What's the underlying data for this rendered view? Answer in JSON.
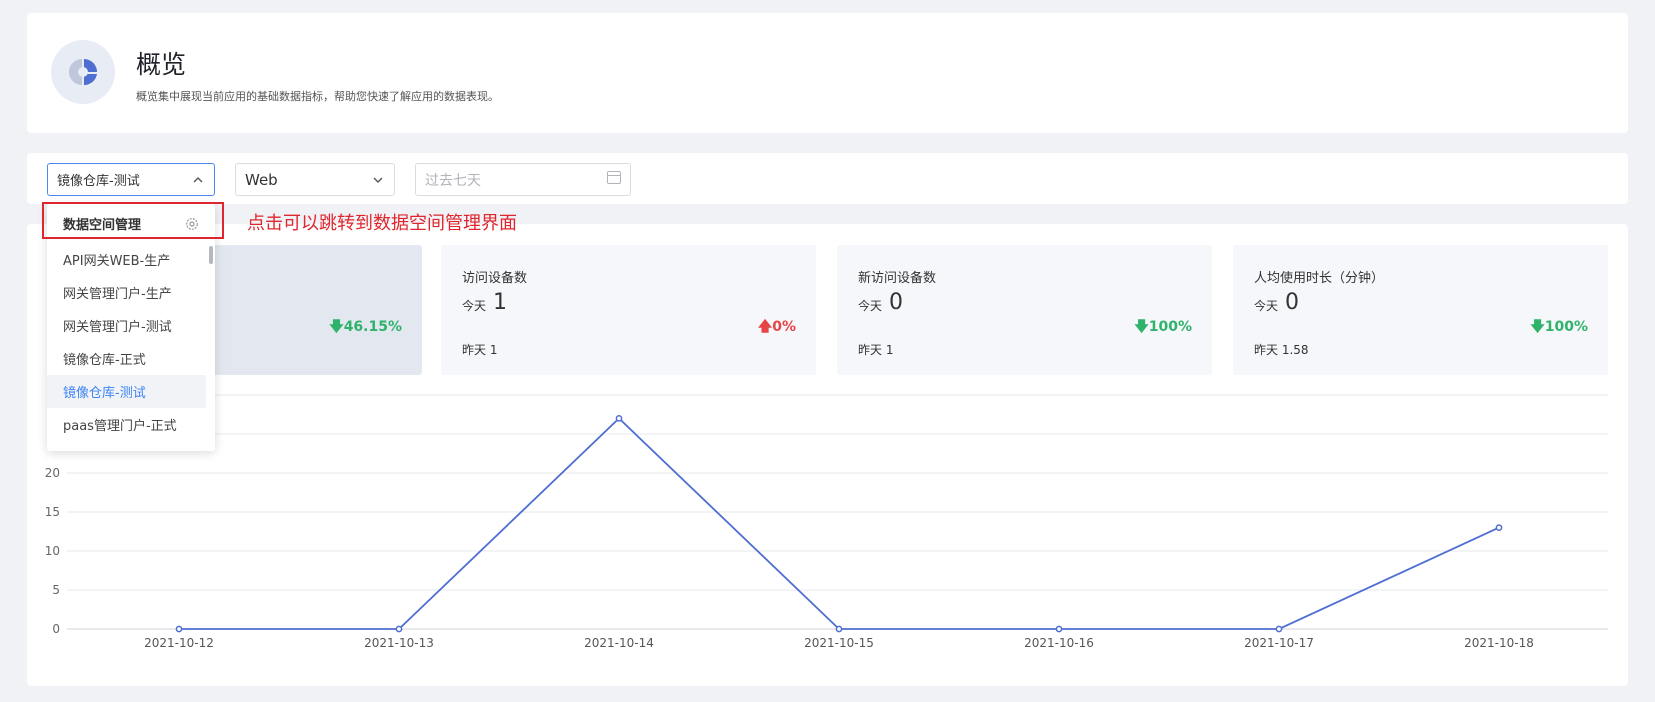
{
  "header": {
    "title": "概览",
    "description": "概览集中展现当前应用的基础数据指标，帮助您快速了解应用的数据表现。",
    "logo_icon": "pie-chart-icon"
  },
  "filters": {
    "app_select": {
      "value": "镜像仓库-测试"
    },
    "platform_select": {
      "value": "Web"
    },
    "date_picker": {
      "placeholder": "过去七天"
    }
  },
  "dropdown": {
    "header": "数据空间管理",
    "header_icon": "gear-icon",
    "items": [
      {
        "label": "API网关WEB-生产"
      },
      {
        "label": "网关管理门户-生产"
      },
      {
        "label": "网关管理门户-测试"
      },
      {
        "label": "镜像仓库-正式"
      },
      {
        "label": "镜像仓库-测试",
        "selected": true
      },
      {
        "label": "paas管理门户-正式"
      }
    ]
  },
  "annotation": "点击可以跳转到数据空间管理界面",
  "stats": [
    {
      "label": "",
      "today_label": "",
      "today_value": "",
      "yesterday": "",
      "change": "46.15%",
      "direction": "down",
      "active": true
    },
    {
      "label": "访问设备数",
      "today_label": "今天",
      "today_value": "1",
      "yesterday": "昨天  1",
      "change": "0%",
      "direction": "up"
    },
    {
      "label": "新访问设备数",
      "today_label": "今天",
      "today_value": "0",
      "yesterday": "昨天  1",
      "change": "100%",
      "direction": "down"
    },
    {
      "label": "人均使用时长（分钟）",
      "today_label": "今天",
      "today_value": "0",
      "yesterday": "昨天  1.58",
      "change": "100%",
      "direction": "down"
    }
  ],
  "colors": {
    "accent": "#3d84f6",
    "line": "#4e6ed1",
    "up": "#e64545",
    "down": "#2fb36b",
    "annotation": "#e0262d"
  },
  "chart_data": {
    "type": "line",
    "categories": [
      "2021-10-12",
      "2021-10-13",
      "2021-10-14",
      "2021-10-15",
      "2021-10-16",
      "2021-10-17",
      "2021-10-18"
    ],
    "series": [
      {
        "values": [
          0,
          0,
          27,
          0,
          0,
          0,
          13
        ]
      }
    ],
    "y_ticks": [
      0,
      5,
      10,
      15,
      20
    ],
    "ylim": [
      0,
      30
    ],
    "grid": true
  }
}
